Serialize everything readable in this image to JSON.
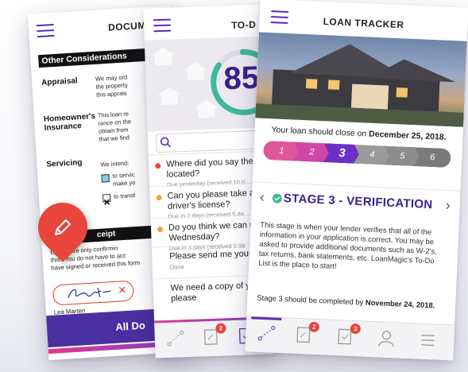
{
  "documents": {
    "title": "DOCUM",
    "section_header": "Other Considerations",
    "appraisal_label": "Appraisal",
    "appraisal_lines": [
      "We may ord",
      "the property",
      "this apprais"
    ],
    "insurance_label_1": "Homeowner's",
    "insurance_label_2": "Insurance",
    "insurance_lines": [
      "This loan re",
      "rance on the",
      "obtain from",
      "that we find"
    ],
    "servicing_label": "Servicing",
    "servicing_intro": "We intend:",
    "servicing_opt1_a": "to servic",
    "servicing_opt1_b": "make yo",
    "servicing_opt2": "to transf",
    "receipt_header": "ceipt",
    "receipt_lines": [
      "By   you are only confirmin",
      "this f  You do not have to acc",
      "have signed or received this form"
    ],
    "signer_name": "Lea Marten",
    "all_docs_button": "All Do"
  },
  "todo": {
    "title": "TO-D",
    "progress_text": "85",
    "progress_value": 85,
    "items": [
      {
        "line1": "Where did you say the h",
        "line2": "located?",
        "due": "Due yesterday (received 10 d",
        "dot": "#e8453c"
      },
      {
        "line1": "Can you please take a p",
        "line2": "driver's license?",
        "due": "Due in 2 days (received 5 da",
        "dot": "#f0a33a"
      },
      {
        "line1": "Do you think we can me",
        "line2": "Wednesday?",
        "due": "Due in 3 days (received 5 da",
        "dot": "#f0a33a"
      },
      {
        "line1": "Please send me your 20",
        "line2": "",
        "due": "Done",
        "dot": ""
      },
      {
        "line1": "We need a copy of your",
        "line2": "please",
        "due": "",
        "dot": ""
      }
    ],
    "tabs": [
      {
        "badge": ""
      },
      {
        "badge": "2"
      },
      {
        "badge": "3"
      }
    ]
  },
  "loan": {
    "title": "LOAN TRACKER",
    "close_prefix": "Your loan should close on ",
    "close_date": "December 25, 2018.",
    "steps": [
      {
        "label": "1",
        "color": "#e0569b"
      },
      {
        "label": "2",
        "color": "#d047a6"
      },
      {
        "label": "3",
        "color": "#6a2fc4"
      },
      {
        "label": "4",
        "color": "#9a9a9a"
      },
      {
        "label": "5",
        "color": "#8c8c8c"
      },
      {
        "label": "6",
        "color": "#7a7a7a"
      }
    ],
    "stage_title": "STAGE 3 - VERIFICATION",
    "stage_body": "This stage is when your lender verifies that all of the information in your application is correct. You may be asked to provide additional documents such as W-2's, tax returns, bank statements, etc. LoanMagic's To-Do List is the place to start!",
    "complete_prefix": "Stage 3 should be completed by ",
    "complete_date": "November 24, 2018.",
    "tabs": [
      {
        "badge": ""
      },
      {
        "badge": "2"
      },
      {
        "badge": "3"
      },
      {
        "badge": ""
      },
      {
        "badge": ""
      }
    ]
  },
  "colors": {
    "brand_purple": "#4a2fa0",
    "accent_red": "#e8453c",
    "accent_pink": "#e0569b"
  }
}
